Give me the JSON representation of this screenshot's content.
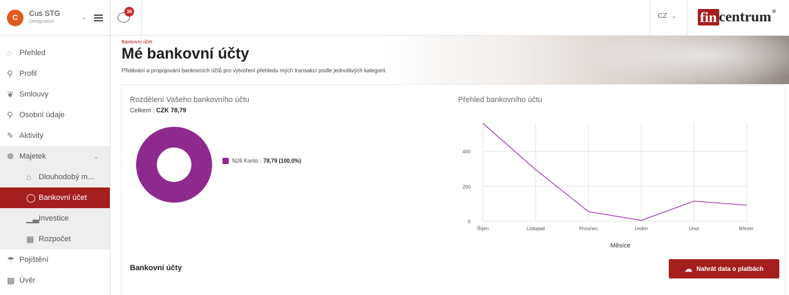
{
  "user": {
    "initial": "C",
    "name": "Cus STG",
    "role": "Designation"
  },
  "topbar": {
    "notifications": "38",
    "language": "CZ",
    "logo_box": "fin",
    "logo_rest": "centrum",
    "logo_mark": "®"
  },
  "sidebar": {
    "items": [
      {
        "label": "Přehled",
        "icon": "gauge-icon"
      },
      {
        "label": "Profil",
        "icon": "person-icon"
      },
      {
        "label": "Smlouvy",
        "icon": "handshake-icon"
      },
      {
        "label": "Osobní údaje",
        "icon": "person-icon"
      },
      {
        "label": "Aktivity",
        "icon": "edit-icon"
      },
      {
        "label": "Majetek",
        "icon": "gem-icon"
      },
      {
        "label": "Dlouhodobý m...",
        "icon": "house-icon"
      },
      {
        "label": "Bankovní účet",
        "icon": "piggy-bank-icon"
      },
      {
        "label": "Investice",
        "icon": "bar-chart-icon"
      },
      {
        "label": "Rozpočet",
        "icon": "calculator-icon"
      },
      {
        "label": "Pojištění",
        "icon": "umbrella-icon"
      },
      {
        "label": "Úvěr",
        "icon": "money-icon"
      }
    ]
  },
  "header": {
    "breadcrumb": "Bankovní účet",
    "title": "Mé bankovní účty",
    "subtitle": "Přidávání a propojování bankovních účtů pro vytvoření přehledu mých transakcí podle jednotlivých kategorií."
  },
  "breakdown": {
    "title": "Rozdělení Vašeho bankovního účtu",
    "total_label": "Celkem :",
    "total_value": "CZK 78,79",
    "legend_name": "N26 Konto :",
    "legend_value": "78,79 (100.0%)"
  },
  "overview_title": "Přehled bankovního účtu",
  "accounts_title": "Bankovní účty",
  "upload_label": "Nahrát data o platbách",
  "colors": {
    "accent": "#a51f1f",
    "donut": "#8e2a8e",
    "line": "#9c3fb0"
  },
  "chart_data": [
    {
      "type": "pie",
      "title": "Rozdělení Vašeho bankovního účtu",
      "categories": [
        "N26 Konto"
      ],
      "values": [
        78.79
      ],
      "donut": true,
      "legend": "right"
    },
    {
      "type": "line",
      "title": "Přehled bankovního účtu",
      "xlabel": "Měsíce",
      "ylabel": "",
      "categories": [
        "Říjen",
        "Listopad",
        "Prosinec",
        "Leden",
        "Únor",
        "Březen"
      ],
      "series": [
        {
          "values": [
            560,
            295,
            55,
            5,
            115,
            92
          ]
        }
      ],
      "yticks": [
        0,
        200,
        400
      ],
      "ylim": [
        0,
        560
      ],
      "grid": true
    }
  ]
}
